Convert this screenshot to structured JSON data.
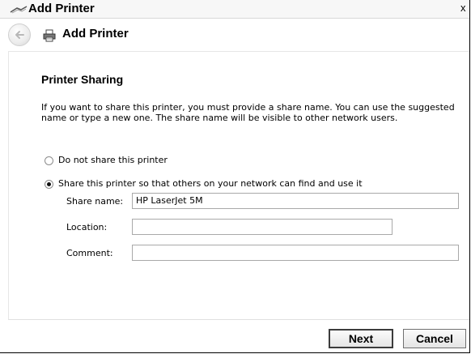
{
  "window": {
    "title": "Add Printer",
    "close_glyph": "x"
  },
  "nav": {
    "title": "Add Printer",
    "back_icon": "back-arrow-icon",
    "printer_icon": "printer-icon"
  },
  "page": {
    "heading": "Printer Sharing",
    "description": "If you want to share this printer, you must provide a share name. You can use the suggested name or type a new one. The share name will be visible to other network users."
  },
  "sharing": {
    "options": [
      {
        "label": "Do not share this printer",
        "selected": false
      },
      {
        "label": "Share this printer so that others on your network can find and use it",
        "selected": true
      }
    ]
  },
  "fields": {
    "share_name": {
      "label": "Share name:",
      "value": "HP LaserJet 5M"
    },
    "location": {
      "label": "Location:",
      "value": ""
    },
    "comment": {
      "label": "Comment:",
      "value": ""
    }
  },
  "buttons": {
    "next": "Next",
    "cancel": "Cancel"
  }
}
